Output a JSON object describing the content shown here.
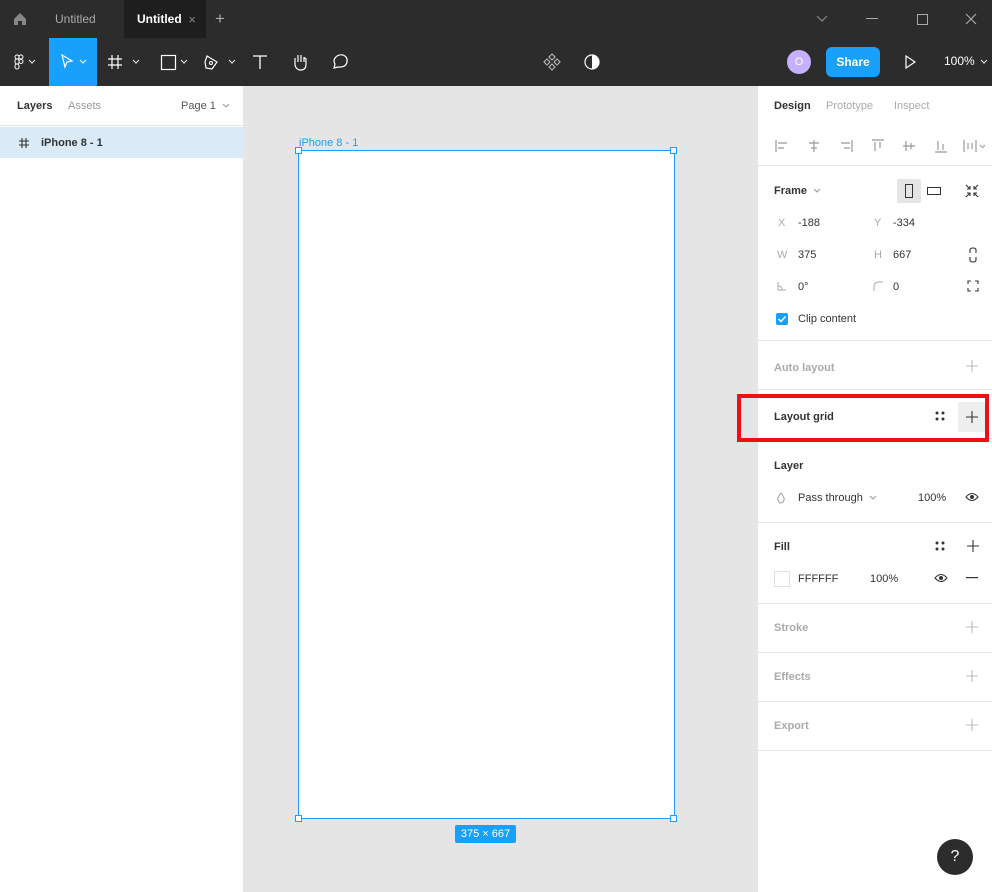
{
  "titlebar": {
    "tabs": [
      {
        "label": "Untitled",
        "active": false
      },
      {
        "label": "Untitled",
        "active": true
      }
    ],
    "close_tab": "×",
    "new_tab": "+"
  },
  "toolbar": {
    "avatar_initial": "O",
    "share_label": "Share",
    "zoom_label": "100%"
  },
  "left_panel": {
    "tabs": {
      "layers": "Layers",
      "assets": "Assets"
    },
    "page_label": "Page 1",
    "layers": [
      {
        "name": "iPhone 8 - 1",
        "icon": "frame-hash-icon"
      }
    ]
  },
  "canvas": {
    "frame_label": "iPhone 8 - 1",
    "size_badge": "375 × 667"
  },
  "right_panel": {
    "tabs": {
      "design": "Design",
      "prototype": "Prototype",
      "inspect": "Inspect"
    },
    "frame": {
      "title": "Frame",
      "x_label": "X",
      "x_value": "-188",
      "y_label": "Y",
      "y_value": "-334",
      "w_label": "W",
      "w_value": "375",
      "h_label": "H",
      "h_value": "667",
      "rotation": "0°",
      "corner_radius": "0",
      "clip_content_label": "Clip content",
      "clip_content_checked": true
    },
    "auto_layout": {
      "title": "Auto layout"
    },
    "layout_grid": {
      "title": "Layout grid"
    },
    "layer": {
      "title": "Layer",
      "blend_mode": "Pass through",
      "opacity": "100%"
    },
    "fill": {
      "title": "Fill",
      "color_hex": "FFFFFF",
      "opacity": "100%"
    },
    "stroke": {
      "title": "Stroke"
    },
    "effects": {
      "title": "Effects"
    },
    "export": {
      "title": "Export"
    }
  },
  "help_label": "?",
  "colors": {
    "accent": "#18a0fb",
    "highlight": "#ee1111",
    "dark": "#2c2c2c"
  }
}
